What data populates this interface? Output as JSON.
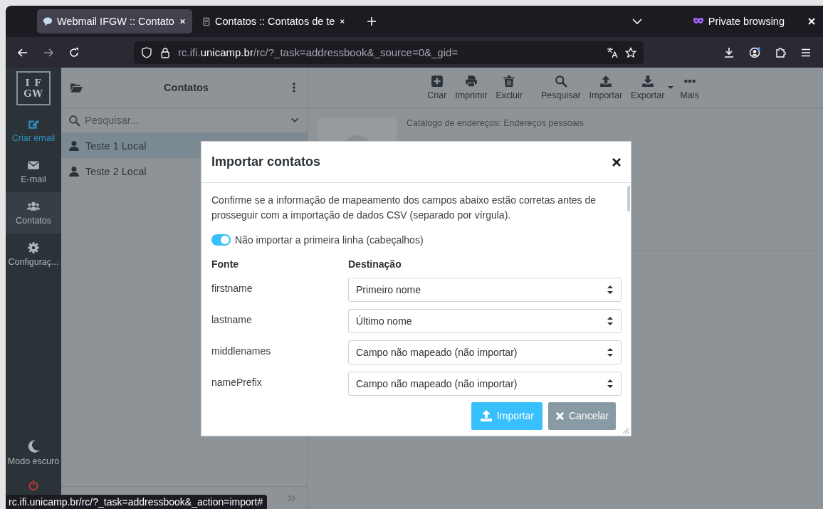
{
  "browser": {
    "tabs": [
      {
        "title": "Webmail IFGW :: Contato",
        "selected": true,
        "kind": "mail"
      },
      {
        "title": "Contatos :: Contatos de te",
        "selected": false,
        "kind": "doc"
      }
    ],
    "private_label": "Private browsing",
    "url": {
      "subdomain": "rc.ifi.",
      "domain": "unicamp.br",
      "path": "/rc/?_task=addressbook&_source=0&_gid="
    }
  },
  "sidebar": {
    "logo_lines": [
      "I F",
      "GW"
    ],
    "items": [
      {
        "label": "Criar email",
        "kind": "compose",
        "selected": false
      },
      {
        "label": "E-mail",
        "kind": "mail",
        "selected": false
      },
      {
        "label": "Contatos",
        "kind": "contacts",
        "selected": true
      },
      {
        "label": "Configuraç...",
        "kind": "settings",
        "selected": false
      }
    ],
    "bottom": [
      {
        "label": "Modo escuro",
        "kind": "moon"
      },
      {
        "kind": "power"
      }
    ]
  },
  "contacts": {
    "title": "Contatos",
    "search": {
      "placeholder": "Pesquisar..."
    },
    "items": [
      {
        "name": "Teste 1 Local",
        "selected": true
      },
      {
        "name": "Teste 2 Local",
        "selected": false
      }
    ]
  },
  "toolbar": [
    {
      "label": "Criar",
      "kind": "create"
    },
    {
      "label": "Imprimir",
      "kind": "print"
    },
    {
      "label": "Excluir",
      "kind": "delete"
    },
    {
      "label": "Pesquisar",
      "kind": "search"
    },
    {
      "label": "Importar",
      "kind": "import"
    },
    {
      "label": "Exportar",
      "kind": "export"
    },
    {
      "label": "Mais",
      "kind": "more"
    }
  ],
  "contact": {
    "addressbook": "Catálogo de endereços: Endereços pessoais"
  },
  "dialog": {
    "title": "Importar contatos",
    "intro": "Confirme se a informação de mapeamento dos campos abaixo estão corretas antes de prosseguir com a importação de dados CSV (separado por vírgula).",
    "skip_header": {
      "label": "Não importar a primeira linha (cabeçalhos)",
      "on": true
    },
    "columns": [
      "Fonte",
      "Destinação"
    ],
    "mappings": [
      {
        "source": "firstname",
        "target": "Primeiro nome"
      },
      {
        "source": "lastname",
        "target": "Último nome"
      },
      {
        "source": "middlenames",
        "target": "Campo não mapeado (não importar)"
      },
      {
        "source": "namePrefix",
        "target": "Campo não mapeado (não importar)"
      }
    ],
    "buttons": [
      {
        "label": "Importar",
        "kind": "primary"
      },
      {
        "label": "Cancelar",
        "kind": "cancel"
      }
    ]
  },
  "status_url": "rc.ifi.unicamp.br/rc/?_task=addressbook&_action=import#"
}
